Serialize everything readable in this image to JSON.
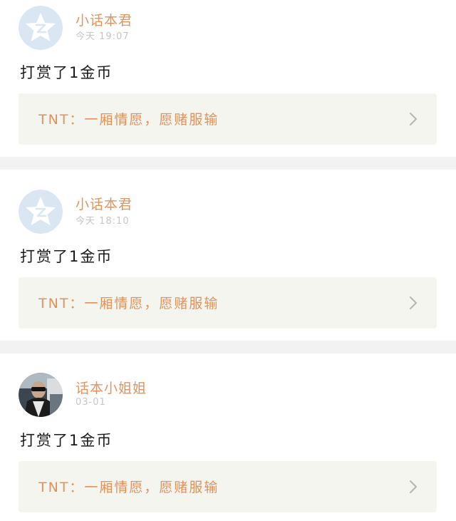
{
  "feed": {
    "items": [
      {
        "username": "小话本君",
        "time": "今天 19:07",
        "content": "打赏了1金币",
        "avatar_type": "qzone-default-star-icon",
        "link_text": "TNT：一厢情愿，愿赌服输",
        "chevron": "chevron-right-icon"
      },
      {
        "username": "小话本君",
        "time": "今天 18:10",
        "content": "打赏了1金币",
        "avatar_type": "qzone-default-star-icon",
        "link_text": "TNT：一厢情愿，愿赌服输",
        "chevron": "chevron-right-icon"
      },
      {
        "username": "话本小姐姐",
        "time": "03-01",
        "content": "打赏了1金币",
        "avatar_type": "user-photo-avatar",
        "link_text": "TNT：一厢情愿，愿赌服输",
        "chevron": "chevron-right-icon"
      }
    ]
  },
  "colors": {
    "username": "#e2945e",
    "time": "#c6c6c6",
    "content": "#1a1a1a",
    "link_card_bg": "#f5f5ef",
    "link_text": "#e0925a",
    "separator": "#f2f2f2",
    "default_avatar_bg": "#dbe6f3"
  }
}
